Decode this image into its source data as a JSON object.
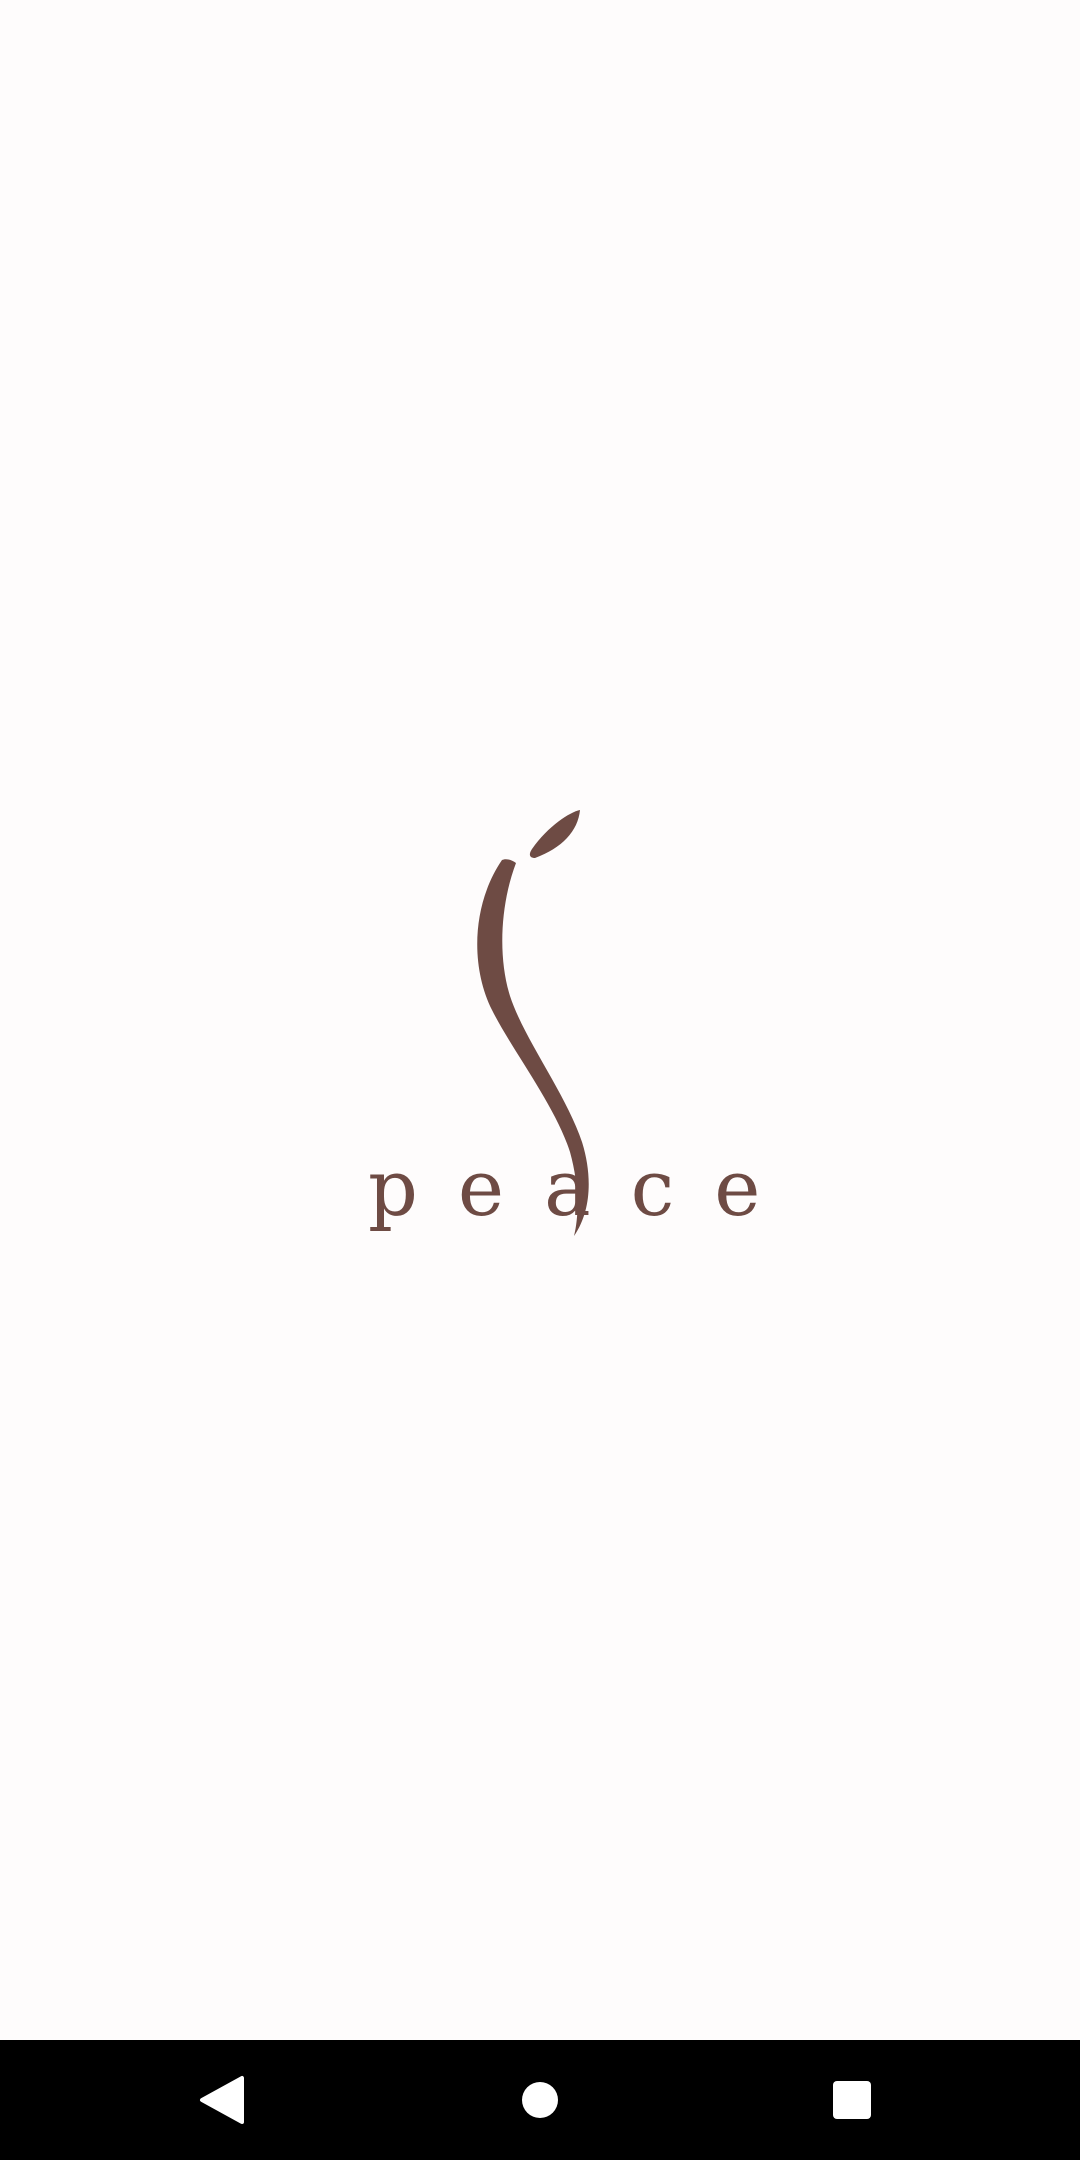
{
  "app": {
    "wordmark": "peace",
    "logo_icon": "dancer-swirl-icon",
    "brand_color": "#6e4b44",
    "background_color": "#fefcfc"
  },
  "navbar": {
    "background_color": "#000000",
    "icon_color": "#ffffff",
    "buttons": [
      {
        "icon": "back-triangle-icon"
      },
      {
        "icon": "home-circle-icon"
      },
      {
        "icon": "recents-square-icon"
      }
    ]
  }
}
